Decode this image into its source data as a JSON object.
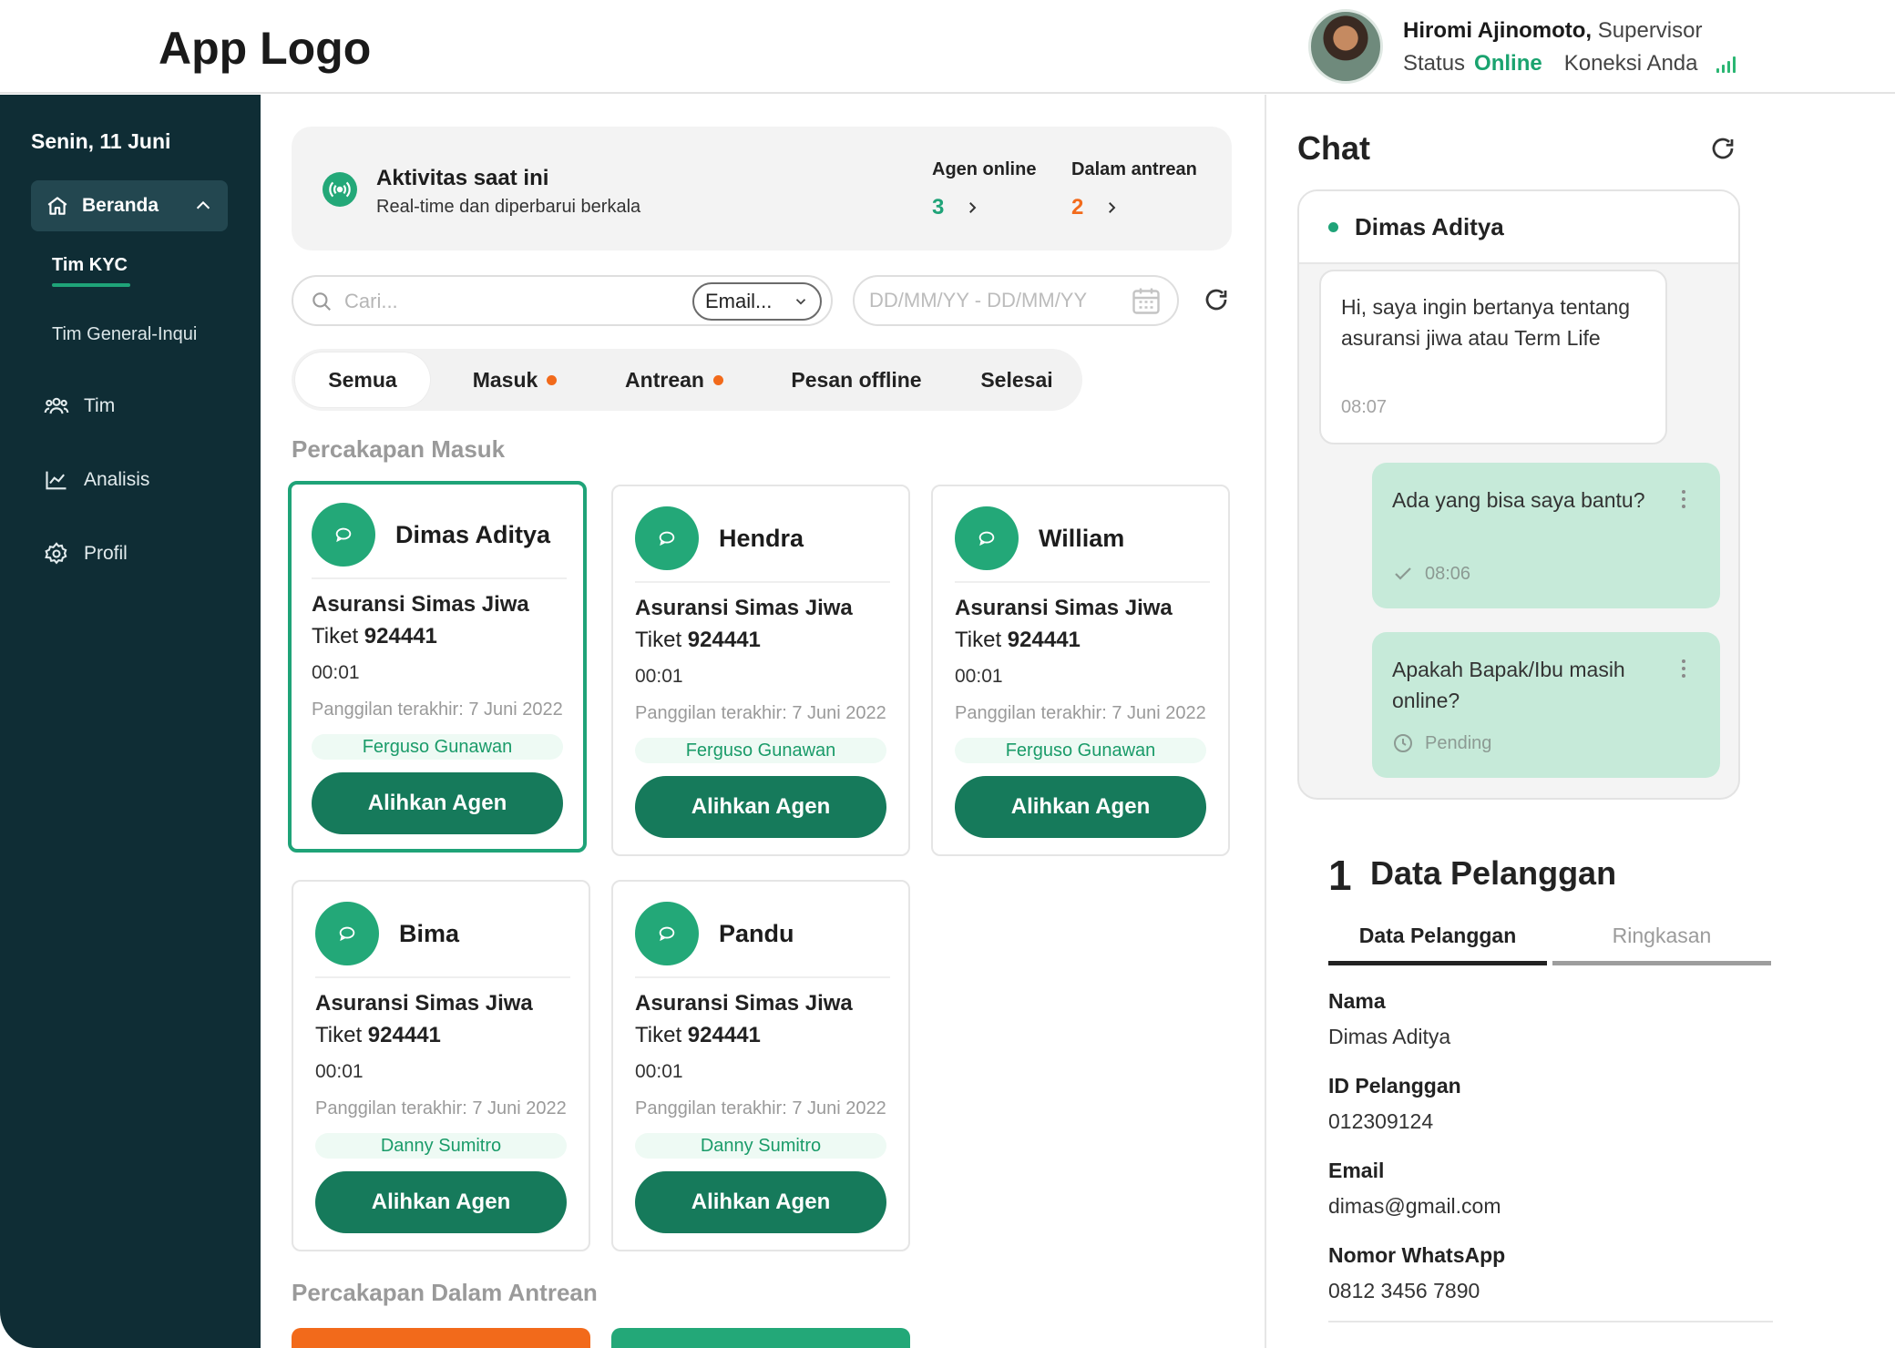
{
  "app": {
    "logo": "App Logo"
  },
  "user": {
    "name": "Hiromi Ajinomoto,",
    "role": "Supervisor",
    "status_label": "Status",
    "status_value": "Online",
    "connection_label": "Koneksi Anda"
  },
  "colors": {
    "brand": "#167a5b",
    "accent_green": "#1fa378",
    "sidebar_bg": "#0f2d35",
    "alert_orange": "#f26a1b"
  },
  "sidebar": {
    "date": "Senin, 11 Juni",
    "home_label": "Beranda",
    "sub_items": [
      "Tim KYC",
      "Tim General-Inqui"
    ],
    "items": [
      {
        "label": "Tim",
        "icon": "team-icon"
      },
      {
        "label": "Analisis",
        "icon": "chart-icon"
      },
      {
        "label": "Profil",
        "icon": "gear-icon"
      }
    ]
  },
  "activity": {
    "title": "Aktivitas saat ini",
    "subtitle": "Real-time dan diperbarui berkala",
    "agents_online_label": "Agen online",
    "agents_online_value": "3",
    "queue_label": "Dalam antrean",
    "queue_value": "2"
  },
  "filters": {
    "search_placeholder": "Cari...",
    "search_type": "Email...",
    "date_placeholder": "DD/MM/YY - DD/MM/YY"
  },
  "tabs": [
    "Semua",
    "Masuk",
    "Antrean",
    "Pesan offline",
    "Selesai"
  ],
  "incoming": {
    "title": "Percakapan Masuk",
    "cards": [
      {
        "name": "Dimas Aditya",
        "product": "Asuransi Simas Jiwa",
        "ticket_label": "Tiket",
        "ticket": "924441",
        "time": "00:01",
        "last_call": "Panggilan terakhir: 7 Juni 2022",
        "agent": "Ferguso Gunawan",
        "button": "Alihkan Agen"
      },
      {
        "name": "Hendra",
        "product": "Asuransi Simas Jiwa",
        "ticket_label": "Tiket",
        "ticket": "924441",
        "time": "00:01",
        "last_call": "Panggilan terakhir: 7 Juni 2022",
        "agent": "Ferguso Gunawan",
        "button": "Alihkan Agen"
      },
      {
        "name": "William",
        "product": "Asuransi Simas Jiwa",
        "ticket_label": "Tiket",
        "ticket": "924441",
        "time": "00:01",
        "last_call": "Panggilan terakhir: 7 Juni 2022",
        "agent": "Ferguso Gunawan",
        "button": "Alihkan Agen"
      },
      {
        "name": "Bima",
        "product": "Asuransi Simas Jiwa",
        "ticket_label": "Tiket",
        "ticket": "924441",
        "time": "00:01",
        "last_call": "Panggilan terakhir: 7 Juni 2022",
        "agent": "Danny Sumitro",
        "button": "Alihkan Agen"
      },
      {
        "name": "Pandu",
        "product": "Asuransi Simas Jiwa",
        "ticket_label": "Tiket",
        "ticket": "924441",
        "time": "00:01",
        "last_call": "Panggilan terakhir: 7 Juni 2022",
        "agent": "Danny Sumitro",
        "button": "Alihkan Agen"
      }
    ]
  },
  "queue": {
    "title": "Percakapan Dalam Antrean"
  },
  "chat": {
    "title": "Chat",
    "contact": "Dimas Aditya",
    "messages": [
      {
        "text": "Hi, saya ingin bertanya tentang asuransi jiwa atau Term Life",
        "time": "08:07"
      },
      {
        "text": "Ada yang bisa saya bantu?",
        "time": "08:06"
      },
      {
        "text": "Apakah Bapak/Ibu masih online?",
        "time": "Pending"
      }
    ]
  },
  "customer": {
    "number": "1",
    "title": "Data Pelanggan",
    "tabs": [
      "Data Pelanggan",
      "Ringkasan"
    ],
    "fields": [
      {
        "label": "Nama",
        "value": "Dimas Aditya"
      },
      {
        "label": "ID Pelanggan",
        "value": "012309124"
      },
      {
        "label": "Email",
        "value": "dimas@gmail.com"
      },
      {
        "label": "Nomor WhatsApp",
        "value": "0812 3456 7890"
      }
    ]
  }
}
